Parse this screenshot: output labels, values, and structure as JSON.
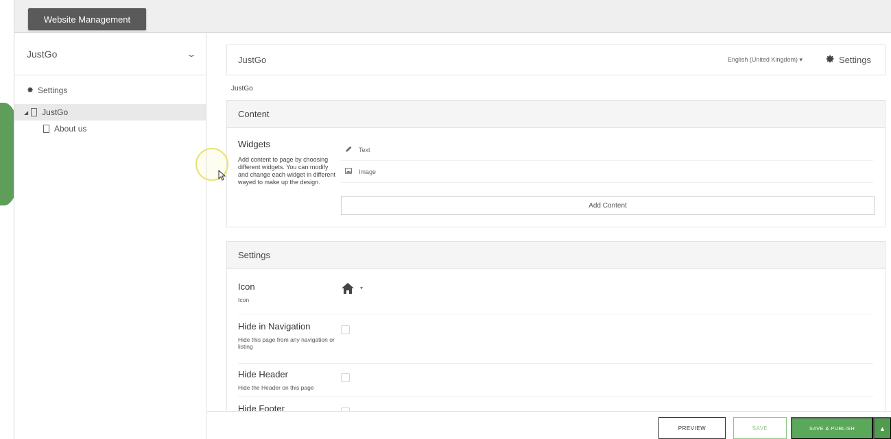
{
  "topbar": {
    "title_button": "Website Management"
  },
  "sidebar": {
    "site_name": "JustGo",
    "settings_label": "Settings",
    "tree": [
      {
        "label": "JustGo",
        "active": true
      },
      {
        "label": "About us",
        "active": false
      }
    ]
  },
  "page_header": {
    "title": "JustGo",
    "language": "English (United Kingdom)",
    "settings_label": "Settings"
  },
  "breadcrumb": "JustGo",
  "content_panel": {
    "title": "Content",
    "widgets_title": "Widgets",
    "widgets_desc": "Add content to page by choosing different widgets. You can modify and change each widget in different wayed to make up the design.",
    "widget_items": [
      {
        "icon": "pencil-icon",
        "label": "Text"
      },
      {
        "icon": "image-icon",
        "label": "Image"
      }
    ],
    "add_content_label": "Add Content"
  },
  "settings_panel": {
    "title": "Settings",
    "rows": [
      {
        "label": "Icon",
        "desc": "Icon",
        "control": "home-icon"
      },
      {
        "label": "Hide in Navigation",
        "desc": "Hide this page from any navigation or listing",
        "control": "checkbox"
      },
      {
        "label": "Hide Header",
        "desc": "Hide the Header on this page",
        "control": "checkbox"
      },
      {
        "label": "Hide Footer",
        "desc": "",
        "control": "checkbox"
      }
    ]
  },
  "footer": {
    "preview_label": "PREVIEW",
    "save_label": "SAVE",
    "save_publish_label": "SAVE & PUBLISH"
  },
  "colors": {
    "accent_green": "#5aa85a",
    "dark_button": "#5a5a5a",
    "highlight_yellow": "#e8e36a"
  }
}
